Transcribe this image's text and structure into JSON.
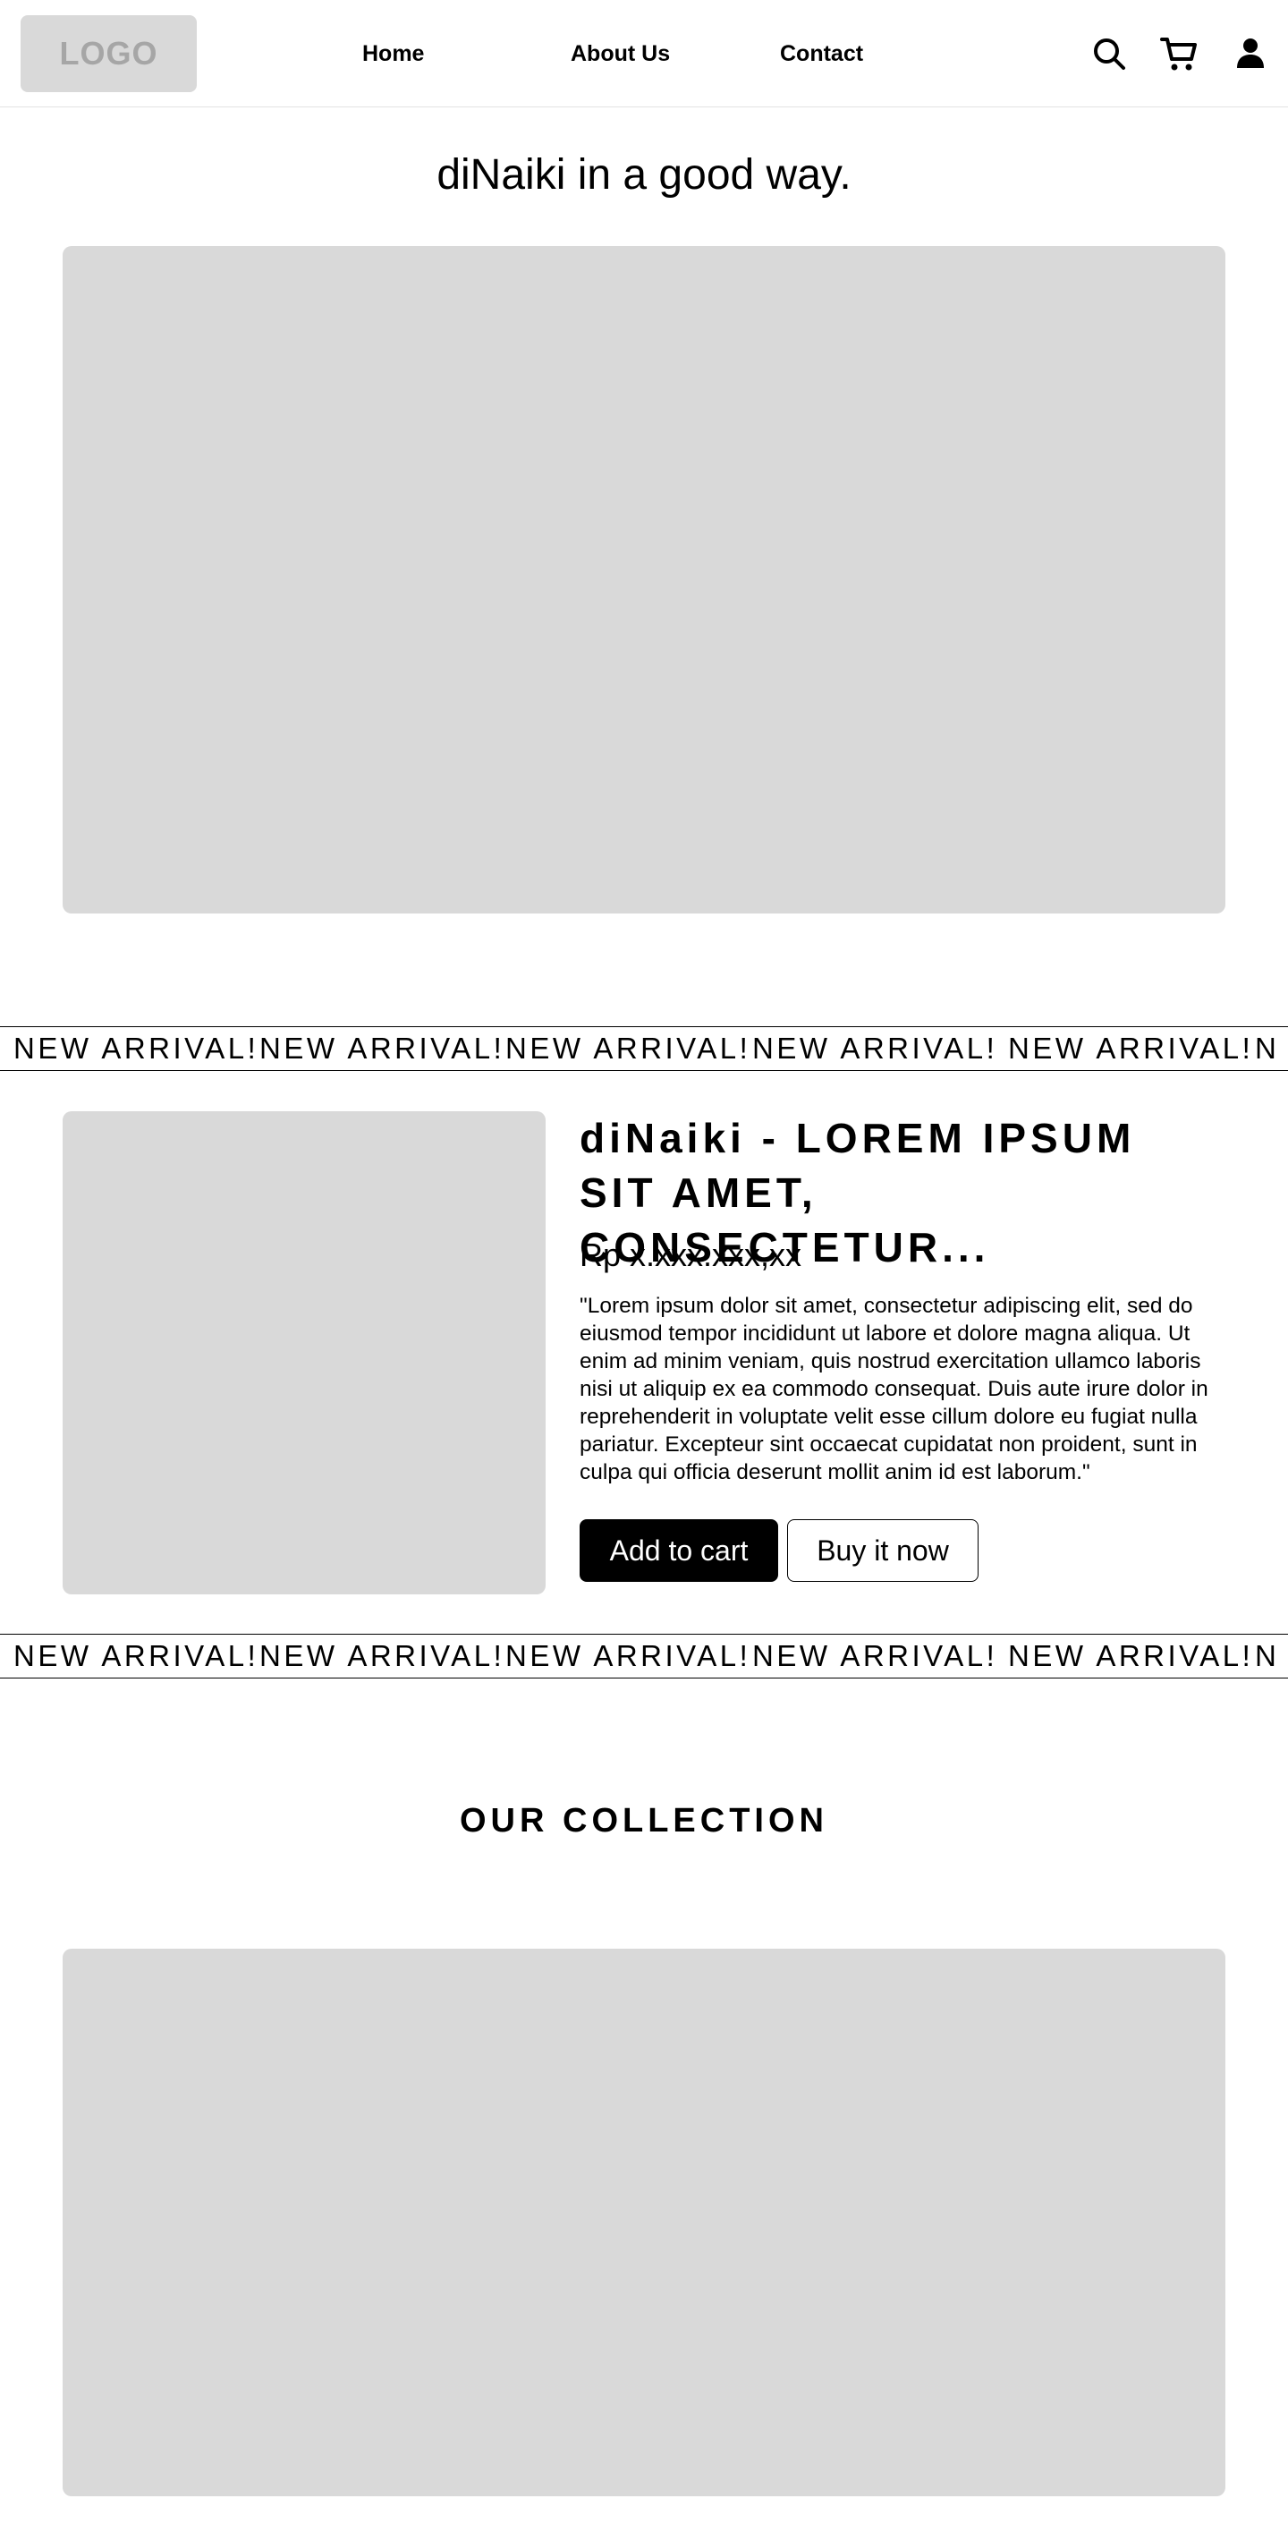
{
  "header": {
    "logo_text": "LOGO",
    "nav": [
      "Home",
      "About Us",
      "Contact"
    ],
    "icons": [
      "search-icon",
      "cart-icon",
      "user-icon"
    ]
  },
  "hero": {
    "title": "diNaiki in a good way."
  },
  "marquee": {
    "items": [
      "NEW ARRIVAL!",
      "NEW ARRIVAL!",
      "NEW ARRIVAL!",
      "NEW ARRIVAL!",
      "NEW ARRIVAL!",
      "N"
    ]
  },
  "product": {
    "title_line1": "diNaiki - LOREM IPSUM",
    "title_line2": "SIT AMET, CONSECTETUR...",
    "price": "Rp x.xxx.xxx,xx",
    "description": "\"Lorem ipsum dolor sit amet, consectetur adipiscing elit, sed do eiusmod tempor incididunt ut labore et dolore magna aliqua. Ut enim ad minim veniam, quis nostrud exercitation ullamco laboris nisi ut aliquip ex ea commodo consequat. Duis aute irure dolor in reprehenderit in voluptate velit esse cillum dolore eu fugiat nulla pariatur. Excepteur sint occaecat cupidatat non proident, sunt in culpa qui officia deserunt mollit anim id est laborum.\"",
    "add_to_cart_label": "Add to cart",
    "buy_now_label": "Buy it now"
  },
  "collection": {
    "title": "OUR COLLECTION"
  },
  "colors": {
    "placeholder": "#d9d9d9",
    "logo_text": "#a6a6a6",
    "primary": "#000000",
    "background": "#ffffff"
  }
}
